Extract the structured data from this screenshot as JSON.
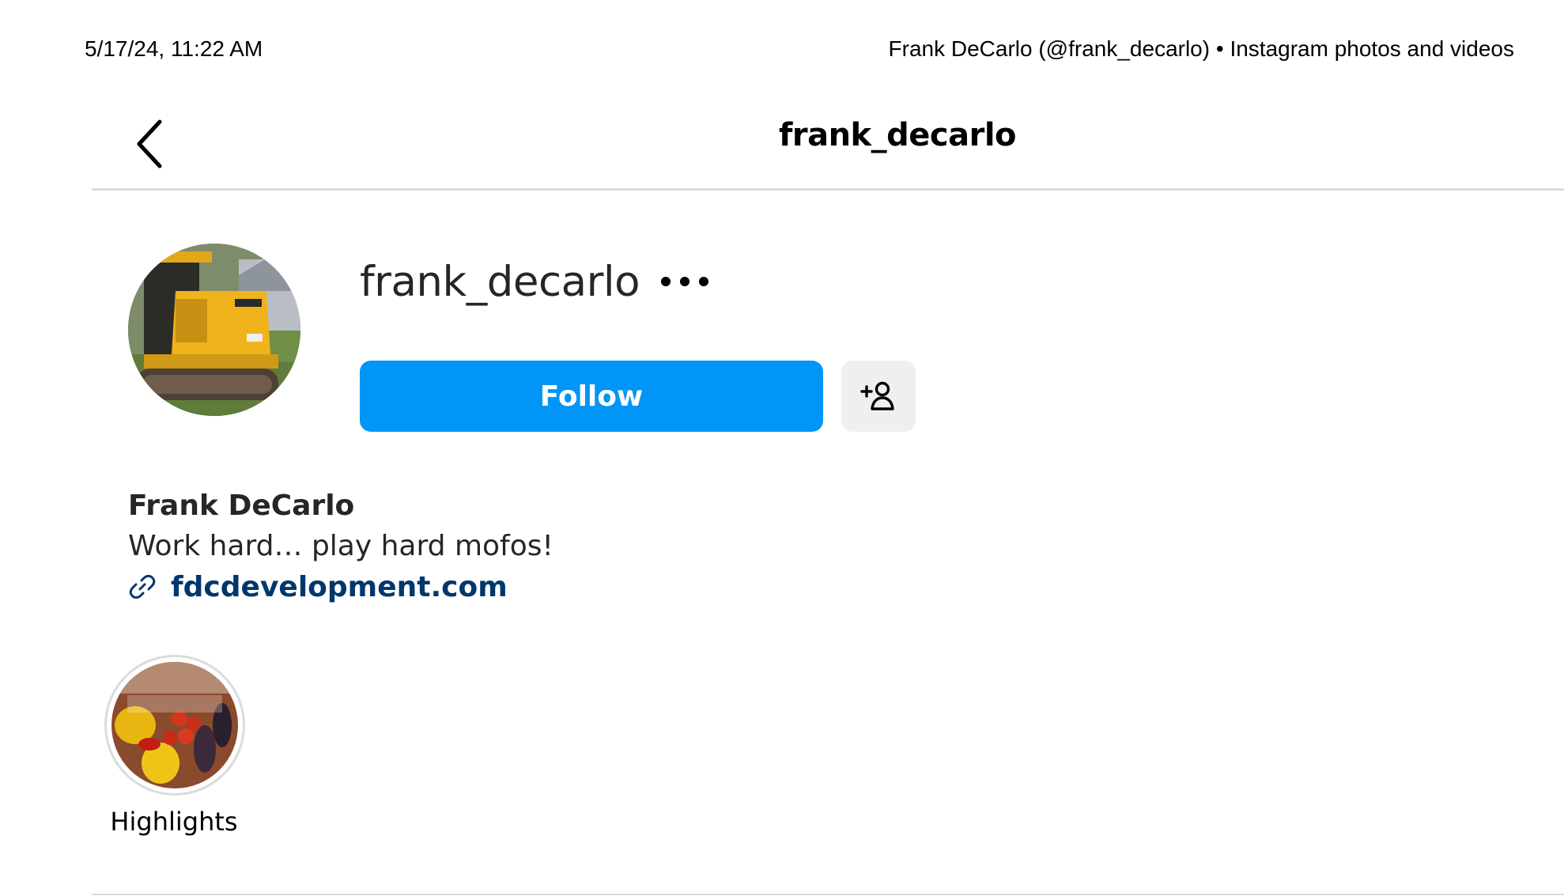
{
  "print_header": {
    "timestamp": "5/17/24, 11:22 AM",
    "page_title": "Frank DeCarlo (@frank_decarlo) • Instagram photos and videos"
  },
  "topbar": {
    "back_icon": "chevron-left-icon",
    "title": "frank_decarlo"
  },
  "profile": {
    "username": "frank_decarlo",
    "more_icon": "more-horizontal-icon",
    "follow_label": "Follow",
    "suggest_icon": "add-person-icon",
    "full_name": "Frank DeCarlo",
    "bio": "Work hard… play hard mofos!",
    "link_icon": "link-icon",
    "link": "fdcdevelopment.com"
  },
  "highlights": [
    {
      "label": "Highlights"
    }
  ],
  "colors": {
    "follow_button": "#0095f6",
    "link_text": "#00376b",
    "secondary_button": "#efefef",
    "divider": "#dbdbdb"
  }
}
